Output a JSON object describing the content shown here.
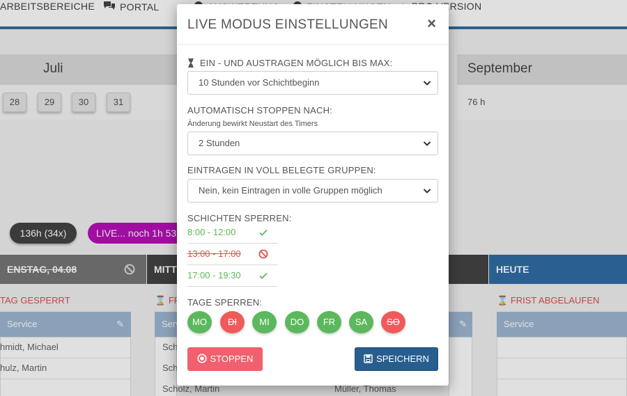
{
  "nav": {
    "items": [
      {
        "label": "ARBEITSBEREICHE",
        "icon": "none"
      },
      {
        "label": "PORTAL",
        "icon": "chat-icon"
      },
      {
        "label": "AUSWERTUNG",
        "icon": "chart-icon"
      },
      {
        "label": "EINSTELLUNGEN",
        "icon": "gear-icon"
      },
      {
        "label": "PRO VERSION",
        "icon": "star-icon"
      }
    ]
  },
  "calendar": {
    "month_left": "Juli",
    "month_right": "September",
    "days": [
      "28",
      "29",
      "30",
      "31"
    ],
    "hours_right": "76 h"
  },
  "summary": {
    "hours_pill": "136h (34x)",
    "live_pill": "LIVE... noch 1h 53"
  },
  "columns": [
    {
      "title": "ENSTAG, 04.08",
      "status": "TAG GESPERRT",
      "card_title": "Service",
      "people": [
        "hmidt, Michael",
        "hulz, Martin"
      ]
    },
    {
      "title": "MITT",
      "status": "FR",
      "card_title": "Serv",
      "people": [
        "Schm",
        "Sch",
        "Scholz, Martin"
      ]
    },
    {
      "title": "",
      "status": "",
      "card_title": "",
      "people": [
        "Müller, Thomas"
      ]
    },
    {
      "title": "HEUTE",
      "status": "FRIST ABGELAUFEN",
      "card_title": "Service",
      "people": []
    }
  ],
  "modal": {
    "title": "LIVE MODUS EINSTELLUNGEN",
    "close_label": "×",
    "max_label": "EIN - UND AUSTRAGEN MÖGLICH BIS MAX:",
    "max_value": "10 Stunden vor Schichtbeginn",
    "auto_stop_label": "AUTOMATISCH STOPPEN NACH:",
    "auto_stop_hint": "Änderung bewirkt Neustart des Timers",
    "auto_stop_value": "2 Stunden",
    "full_groups_label": "EINTRAGEN IN VOLL BELEGTE GRUPPEN:",
    "full_groups_value": "Nein, kein Eintragen in volle Gruppen möglich",
    "shifts_label": "SCHICHTEN SPERREN:",
    "shifts": [
      {
        "time": "8:00 - 12:00",
        "blocked": false
      },
      {
        "time": "13:00 - 17:00",
        "blocked": true
      },
      {
        "time": "17:00 - 19:30",
        "blocked": false
      }
    ],
    "days_label": "TAGE SPERREN:",
    "days": [
      {
        "label": "MO",
        "blocked": false
      },
      {
        "label": "DI",
        "blocked": true
      },
      {
        "label": "MI",
        "blocked": false
      },
      {
        "label": "DO",
        "blocked": false
      },
      {
        "label": "FR",
        "blocked": false
      },
      {
        "label": "SA",
        "blocked": false
      },
      {
        "label": "SO",
        "blocked": true
      }
    ],
    "stop_label": "STOPPEN",
    "save_label": "SPEICHERN"
  },
  "colors": {
    "nav_accent": "#2f6ea5",
    "ok_green": "#5cb85c",
    "blocked_red": "#f05a5a",
    "save_blue": "#285e8e",
    "stop_red": "#f0606e",
    "live_purple": "#b80fb8"
  }
}
